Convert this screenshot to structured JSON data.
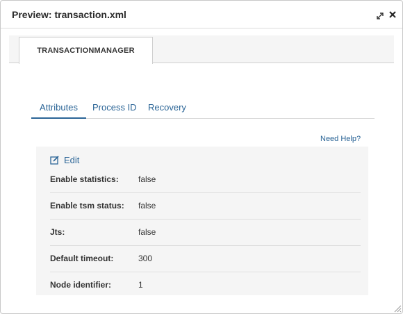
{
  "window": {
    "title": "Preview: transaction.xml"
  },
  "outer_tab": {
    "label": "TRANSACTIONMANAGER"
  },
  "tabs": [
    {
      "label": "Attributes",
      "active": true
    },
    {
      "label": "Process ID",
      "active": false
    },
    {
      "label": "Recovery",
      "active": false
    }
  ],
  "help": {
    "label": "Need Help?"
  },
  "panel": {
    "edit_label": "Edit",
    "rows": [
      {
        "label": "Enable statistics:",
        "value": "false"
      },
      {
        "label": "Enable tsm status:",
        "value": "false"
      },
      {
        "label": "Jts:",
        "value": "false"
      },
      {
        "label": "Default timeout:",
        "value": "300"
      },
      {
        "label": "Node identifier:",
        "value": "1"
      }
    ]
  },
  "colors": {
    "link": "#2a6496",
    "text": "#333333",
    "panel_bg": "#f5f5f5"
  },
  "icons": {
    "maximize": "maximize-icon",
    "close": "close-icon",
    "edit": "edit-icon",
    "resize": "resize-grip-icon"
  }
}
